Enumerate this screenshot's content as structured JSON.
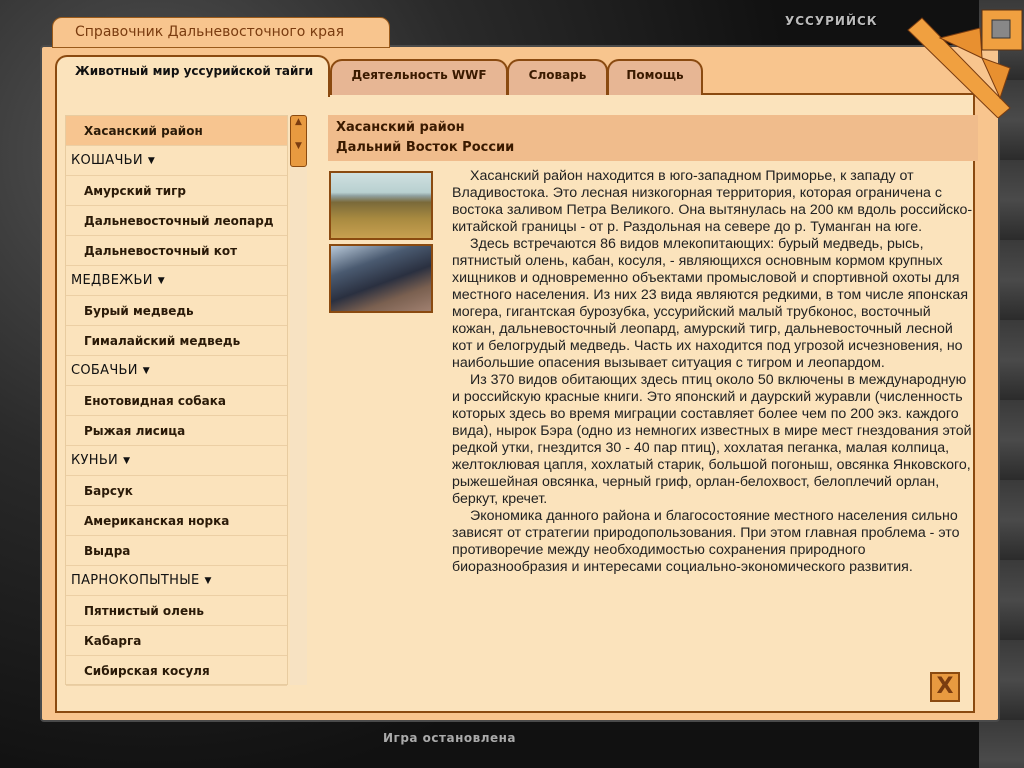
{
  "window": {
    "title": "Справочник Дальневосточного края",
    "city": "УССУРИЙСК",
    "status": "Игра остановлена"
  },
  "tabs": [
    {
      "label": "Животный мир уссурийской тайги",
      "active": true
    },
    {
      "label": "Деятельность WWF"
    },
    {
      "label": "Словарь"
    },
    {
      "label": "Помощь"
    }
  ],
  "list": [
    {
      "label": "Хасанский район",
      "type": "item",
      "selected": true
    },
    {
      "label": "КОШАЧЬИ",
      "type": "category"
    },
    {
      "label": "Амурский тигр",
      "type": "item"
    },
    {
      "label": "Дальневосточный леопард",
      "type": "item"
    },
    {
      "label": "Дальневосточный кот",
      "type": "item"
    },
    {
      "label": "МЕДВЕЖЬИ",
      "type": "category"
    },
    {
      "label": "Бурый медведь",
      "type": "item"
    },
    {
      "label": "Гималайский медведь",
      "type": "item"
    },
    {
      "label": "СОБАЧЬИ",
      "type": "category"
    },
    {
      "label": "Енотовидная собака",
      "type": "item"
    },
    {
      "label": "Рыжая лисица",
      "type": "item"
    },
    {
      "label": "КУНЬИ",
      "type": "category"
    },
    {
      "label": "Барсук",
      "type": "item"
    },
    {
      "label": "Американская норка",
      "type": "item"
    },
    {
      "label": "Выдра",
      "type": "item"
    },
    {
      "label": "ПАРНОКОПЫТНЫЕ",
      "type": "category"
    },
    {
      "label": "Пятнистый олень",
      "type": "item"
    },
    {
      "label": "Кабарга",
      "type": "item"
    },
    {
      "label": "Сибирская косуля",
      "type": "item"
    }
  ],
  "article": {
    "title": "Хасанский район",
    "subtitle": "Дальний Восток России",
    "paragraphs": [
      "Хасанский район находится в юго-западном Приморье, к западу от Владивостока. Это лесная низкогорная территория, которая ограничена с востока заливом Петра Великого. Она вытянулась на 200 км вдоль российско-китайской границы - от р. Раздольная на севере до р. Туманган на юге.",
      "Здесь встречаются 86 видов млекопитающих: бурый медведь, рысь, пятнистый олень, кабан, косуля, - являющихся основным кормом крупных хищников и одновременно объектами промысловой и спортивной охоты для местного населения. Из них 23 вида являются редкими, в том числе японская могера, гигантская бурозубка, уссурийский малый трубконос, восточный кожан, дальневосточный леопард, амурский тигр, дальневосточный лесной кот и белогрудый медведь. Часть их находится под угрозой исчезновения, но наибольшие опасения вызывает ситуация с тигром и леопардом.",
      "Из 370 видов обитающих здесь птиц около 50 включены в международную и российскую красные книги. Это японский и даурский журавли (численность которых здесь во время миграции составляет более чем по 200 экз. каждого вида), нырок Бэра (одно из немногих известных в мире мест гнездования этой редкой утки, гнездится 30 - 40 пар птиц), хохлатая пеганка, малая колпица, желтоклювая цапля, хохлатый старик, большой погоныш, овсянка Янковского, рыжешейная овсянка, черный гриф, орлан-белохвост, белоплечий орлан, беркут, кречет.",
      "Экономика данного района и благосостояние местного населения сильно зависят от стратегии природопользования. При этом главная проблема - это противоречие между необходимостью сохранения природного биоразнообразия и интересами социально-экономического развития."
    ]
  },
  "close_label": "X",
  "colors": {
    "accent": "#f8c58e",
    "panel": "#fbe3bc",
    "border": "#8a4a10"
  }
}
